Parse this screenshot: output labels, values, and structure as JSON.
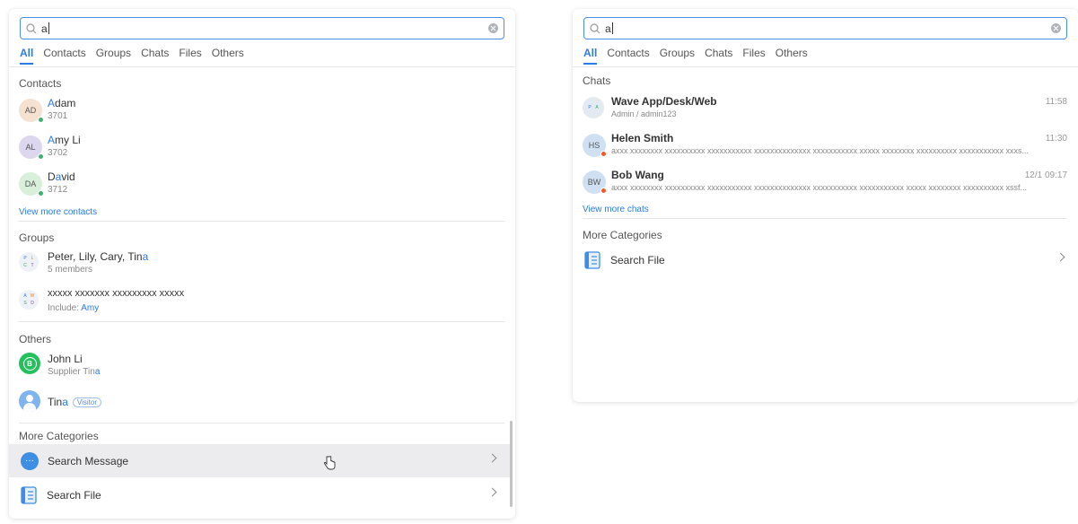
{
  "left": {
    "search": {
      "query": "a"
    },
    "tabs": [
      "All",
      "Contacts",
      "Groups",
      "Chats",
      "Files",
      "Others"
    ],
    "contacts": {
      "title": "Contacts",
      "items": [
        {
          "initials": "AD",
          "name_hl": "A",
          "name_rest": "dam",
          "ext": "3701",
          "avatar_color": "#f5e1d0"
        },
        {
          "initials": "AL",
          "name_hl": "A",
          "name_rest": "my Li",
          "ext": "3702",
          "avatar_color": "#dcd6ef"
        },
        {
          "initials": "DA",
          "name_pre": "D",
          "name_hl": "a",
          "name_rest": "vid",
          "ext": "3712",
          "avatar_color": "#d8efd9"
        }
      ],
      "more_link": "View more contacts"
    },
    "groups": {
      "title": "Groups",
      "items": [
        {
          "av": [
            "P",
            "L",
            "C",
            "T"
          ],
          "name_pre": "Peter, Lily, Cary, Tin",
          "name_hl": "a",
          "sub": "5 members"
        },
        {
          "av": [
            "A",
            "W",
            "S",
            "D"
          ],
          "name_pre": "xxxxx xxxxxxx xxxxxxxxx xxxxx",
          "name_hl": "",
          "sub_prefix": "Include: ",
          "sub_hl": "Amy"
        }
      ]
    },
    "others": {
      "title": "Others",
      "items": [
        {
          "name": "John Li",
          "sub_prefix": "Supplier Tin",
          "sub_hl": "a"
        },
        {
          "name_pre": "Tin",
          "name_hl": "a",
          "badge": "Visitor"
        }
      ]
    },
    "categories": {
      "title": "More Categories",
      "items": [
        {
          "label": "Search Message"
        },
        {
          "label": "Search File"
        }
      ]
    }
  },
  "right": {
    "search": {
      "query": "a"
    },
    "tabs": [
      "All",
      "Contacts",
      "Groups",
      "Chats",
      "Files",
      "Others"
    ],
    "chats": {
      "title": "Chats",
      "items": [
        {
          "name": "Wave App/Desk/Web",
          "time": "11:58",
          "sub": "Admin / admin123",
          "av": [
            "P",
            "A"
          ]
        },
        {
          "initials": "HS",
          "name": "Helen Smith",
          "time": "11:30",
          "sub": "axxx xxxxxxxx xxxxxxxxxx xxxxxxxxxxx xxxxxxxxxxxxxx xxxxxxxxxxx xxxxx xxxxxxxx xxxxxxxxxx xxxxxxxxxxx xxxs..."
        },
        {
          "initials": "BW",
          "name": "Bob Wang",
          "time": "12/1 09:17",
          "sub": "axxx xxxxxxxx xxxxxxxxxx xxxxxxxxxxx xxxxxxxxxxxxxx xxxxxxxxxxx xxxxxxxxxxx xxxxx xxxxxxxx xxxxxxxxxx xssf..."
        }
      ],
      "more_link": "View more chats"
    },
    "categories": {
      "title": "More Categories",
      "items": [
        {
          "label": "Search File"
        }
      ]
    }
  }
}
